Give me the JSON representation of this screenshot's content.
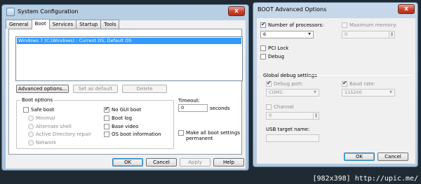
{
  "system_config": {
    "title": "System Configuration",
    "tabs": [
      "General",
      "Boot",
      "Services",
      "Startup",
      "Tools"
    ],
    "os_entries": [
      "Windows 7 (C:\\Windows) : Current OS; Default OS"
    ],
    "buttons": {
      "advanced": "Advanced options...",
      "set_default": "Set as default",
      "delete": "Delete"
    },
    "boot_options": {
      "label": "Boot options",
      "safe_boot": "Safe boot",
      "minimal": "Minimal",
      "alternate_shell": "Alternate shell",
      "active_directory_repair": "Active Directory repair",
      "network": "Network",
      "no_gui_boot": "No GUI boot",
      "boot_log": "Boot log",
      "base_video": "Base video",
      "os_boot_information": "OS boot information"
    },
    "timeout": {
      "label": "Timeout:",
      "value": "0",
      "unit": "seconds"
    },
    "make_permanent": "Make all boot settings permanent",
    "footer": {
      "ok": "OK",
      "cancel": "Cancel",
      "apply": "Apply",
      "help": "Help"
    },
    "close_glyph": "x"
  },
  "boot_advanced": {
    "title": "BOOT Advanced Options",
    "num_processors": {
      "label": "Number of processors:",
      "value": "6"
    },
    "max_memory": {
      "label": "Maximum memory:",
      "value": "0"
    },
    "pci_lock": "PCI Lock",
    "debug": "Debug",
    "global_debug": {
      "label": "Global debug settings",
      "debug_port": {
        "label": "Debug port:",
        "value": "COM1:"
      },
      "baud_rate": {
        "label": "Baud rate:",
        "value": "115200"
      },
      "channel": {
        "label": "Channel",
        "value": "0"
      },
      "usb_target": {
        "label": "USB target name:",
        "value": ""
      }
    },
    "footer": {
      "ok": "OK",
      "cancel": "Cancel"
    },
    "close_glyph": "x"
  },
  "watermark": "[982x398] http://upic.me/"
}
